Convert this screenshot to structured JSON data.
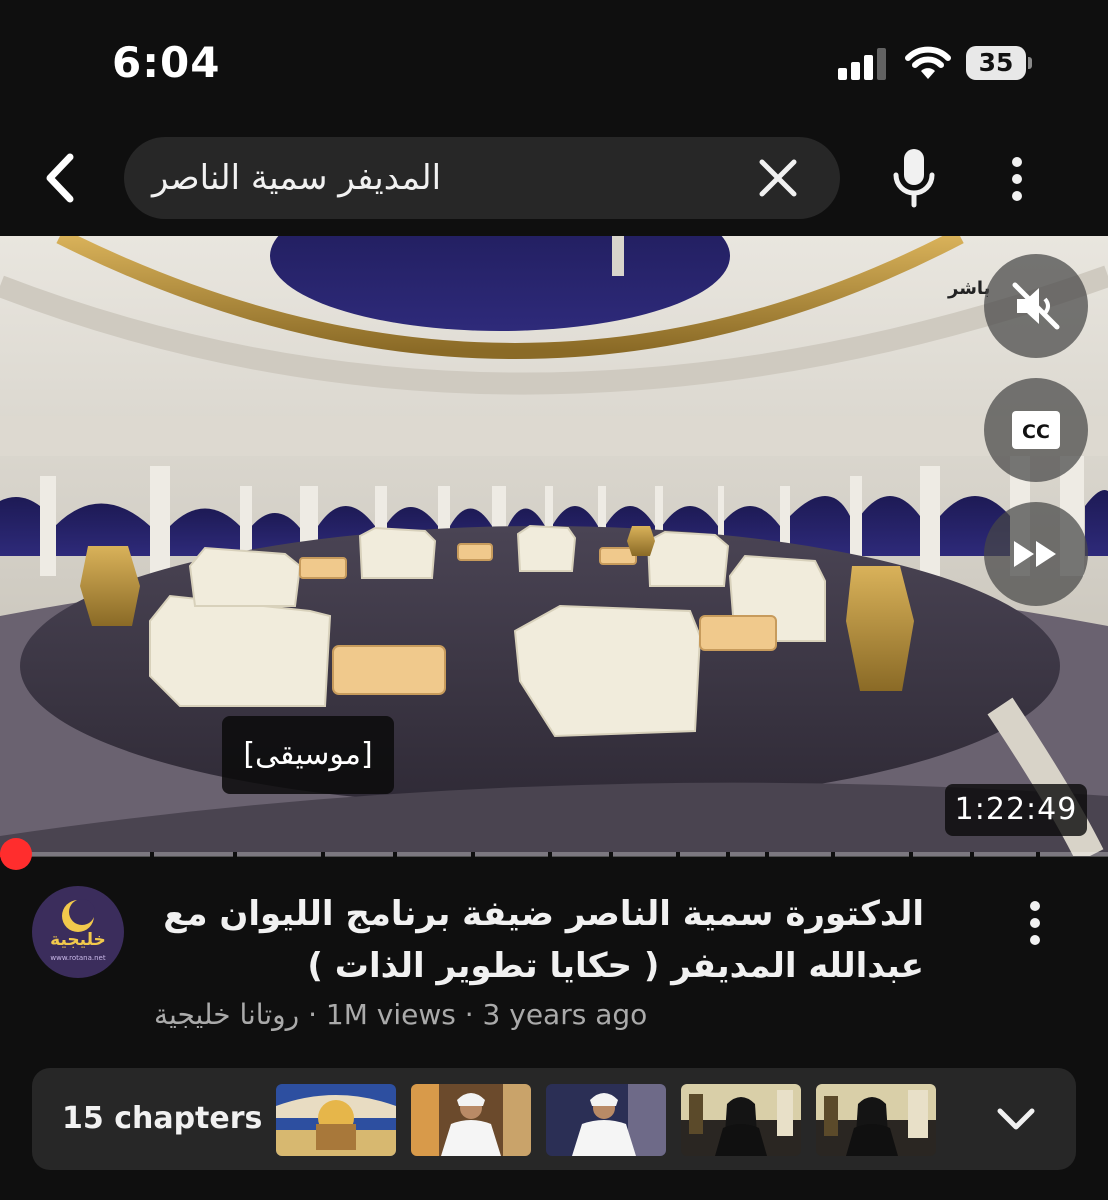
{
  "status_bar": {
    "time": "6:04",
    "battery_level": "35",
    "icons": [
      "cellular-signal-icon",
      "wifi-icon",
      "battery-icon"
    ]
  },
  "header": {
    "search_query": "المديفر سمية الناصر",
    "icons": [
      "back-arrow-icon",
      "clear-icon",
      "mic-icon",
      "more-vertical-icon"
    ]
  },
  "player": {
    "channel_watermark": "باشر",
    "caption_text": "[موسيقى]",
    "duration": "1:22:49",
    "muted": true,
    "controls": [
      "mute-icon",
      "closed-captions-icon",
      "fast-forward-icon"
    ],
    "progress_fraction": 0.01,
    "chapter_marks_count": 15
  },
  "video": {
    "title": "الدكتورة سمية الناصر ضيفة برنامج الليوان مع عبدالله المديفر ( حكايا تطوير الذات )",
    "channel": "روتانا خليجية",
    "avatar_label": "خليجية",
    "avatar_url": "www.rotana.net",
    "views": "1M views",
    "age": "3 years ago",
    "separator": "·"
  },
  "chapters": {
    "label": "15 chapters",
    "thumbnail_count": 5
  },
  "colors": {
    "background": "#0f0f0f",
    "surface": "#272727",
    "progress_red": "#ff0000",
    "secondary_text": "#aaaaaa",
    "avatar_purple": "#3b2d5c",
    "avatar_gold": "#f2c94c"
  }
}
